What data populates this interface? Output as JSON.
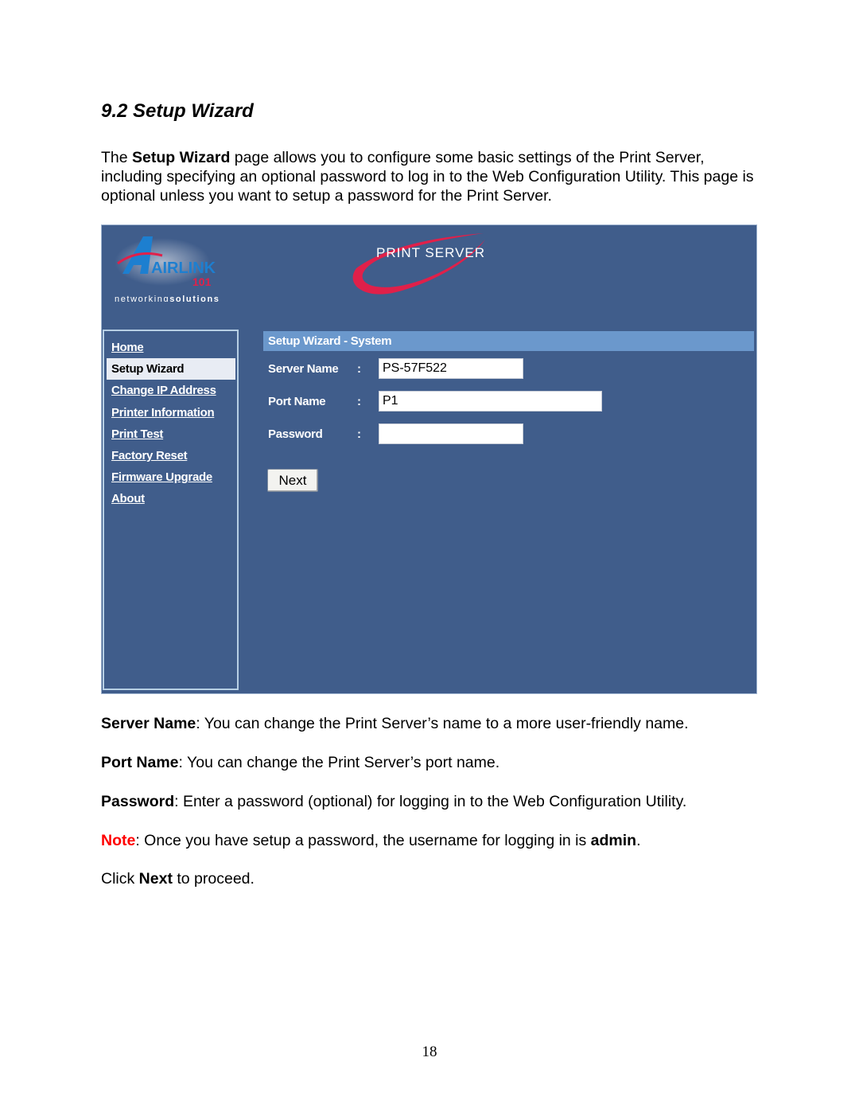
{
  "section": {
    "title": "9.2 Setup Wizard",
    "intro": {
      "pre": "The ",
      "bold": "Setup Wizard",
      "post": " page allows you to configure some basic settings of the Print Server, including specifying an optional password to log in to the Web Configuration Utility. This page is optional unless you want to setup a password for the Print Server."
    }
  },
  "screenshot": {
    "brand": {
      "logo_text": "AIRLINK",
      "logo_number": "101",
      "tagline_light": "networking",
      "tagline_bold": "solutions",
      "product": "PRINT SERVER"
    },
    "colors": {
      "background": "#405d8b",
      "panel_header": "#6b98cc",
      "accent_red": "#e0204a"
    },
    "nav": {
      "items": [
        {
          "label": "Home",
          "active": false
        },
        {
          "label": "Setup Wizard",
          "active": true
        },
        {
          "label": "Change IP Address",
          "active": false
        },
        {
          "label": "Printer Information",
          "active": false
        },
        {
          "label": "Print Test",
          "active": false
        },
        {
          "label": "Factory Reset",
          "active": false
        },
        {
          "label": "Firmware Upgrade",
          "active": false
        },
        {
          "label": "About",
          "active": false
        }
      ]
    },
    "panel": {
      "title": "Setup Wizard - System",
      "fields": [
        {
          "label": "Server Name",
          "separator": ":",
          "value": "PS-57F522"
        },
        {
          "label": "Port Name",
          "separator": ":",
          "value": "P1"
        },
        {
          "label": "Password",
          "separator": ":",
          "value": ""
        }
      ],
      "next_label": "Next"
    }
  },
  "descriptions": {
    "server_name": {
      "term": "Server Name",
      "text": ": You can change the Print Server’s name to a more user-friendly name."
    },
    "port_name": {
      "term": "Port Name",
      "text": ": You can change the Print Server’s port name."
    },
    "password": {
      "term": "Password",
      "text": ": Enter a password (optional) for logging in to the Web Configuration Utility."
    },
    "note": {
      "term": "Note",
      "text": ": Once you have setup a password, the username for logging in is ",
      "bold": "admin",
      "end": "."
    },
    "click_next": {
      "pre": "Click ",
      "bold": "Next",
      "post": " to proceed."
    }
  },
  "page_number": "18"
}
